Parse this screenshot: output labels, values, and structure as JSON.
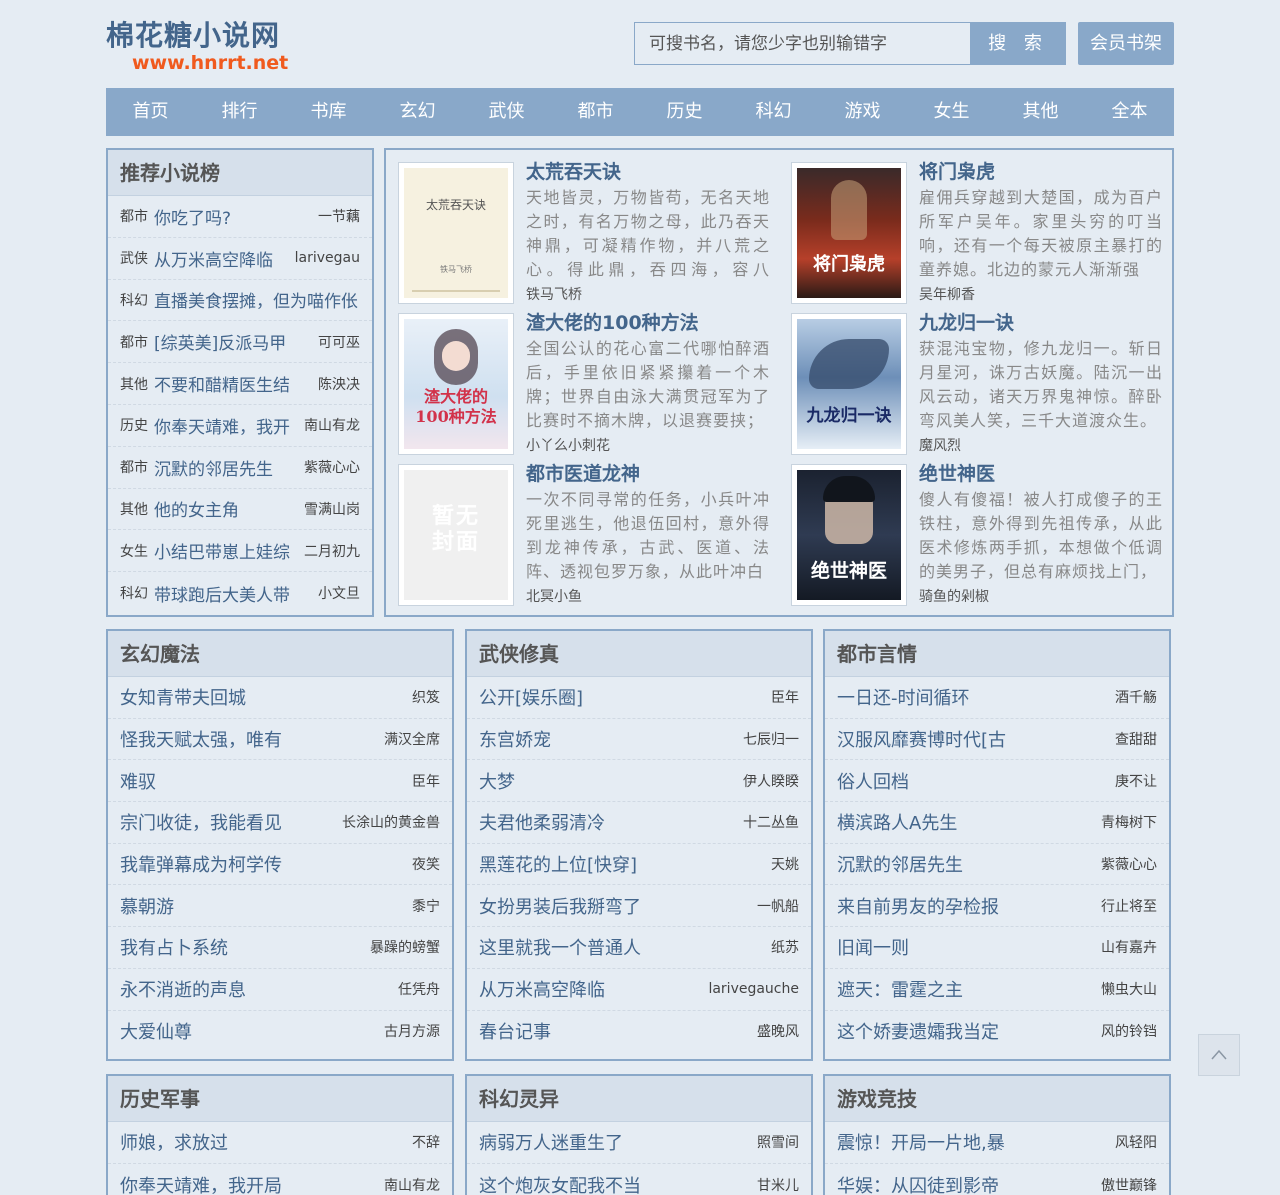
{
  "site": {
    "title": "棉花糖小说网",
    "url": "www.hnrrt.net"
  },
  "search": {
    "placeholder": "可搜书名，请您少字也别输错字",
    "button": "搜 索"
  },
  "member_button": "会员书架",
  "nav": [
    "首页",
    "排行",
    "书库",
    "玄幻",
    "武侠",
    "都市",
    "历史",
    "科幻",
    "游戏",
    "女生",
    "其他",
    "全本"
  ],
  "recommend": {
    "title": "推荐小说榜",
    "items": [
      {
        "cat": "都市",
        "title": "你吃了吗?",
        "author": "一节藕"
      },
      {
        "cat": "武侠",
        "title": "从万米高空降临",
        "author": "larivegau"
      },
      {
        "cat": "科幻",
        "title": "直播美食摆摊，但为喵作伥",
        "author": ""
      },
      {
        "cat": "都市",
        "title": "[综英美]反派马甲",
        "author": "可可巫"
      },
      {
        "cat": "其他",
        "title": "不要和醋精医生结",
        "author": "陈泱决"
      },
      {
        "cat": "历史",
        "title": "你奉天靖难，我开",
        "author": "南山有龙"
      },
      {
        "cat": "都市",
        "title": "沉默的邻居先生",
        "author": "紫薇心心"
      },
      {
        "cat": "其他",
        "title": "他的女主角",
        "author": "雪满山岗"
      },
      {
        "cat": "女生",
        "title": "小结巴带崽上娃综",
        "author": "二月初九"
      },
      {
        "cat": "科幻",
        "title": "带球跑后大美人带",
        "author": "小文旦"
      }
    ]
  },
  "featured": [
    {
      "title": "太荒吞天诀",
      "desc": "天地皆灵，万物皆苟，无名天地之时，有名万物之母，此乃吞天神鼎，可凝精作物，并八荒之心。得此鼎，吞四海，容八荒……",
      "author": "铁马飞桥",
      "cover_text": "太荒吞天诀",
      "cover_author": "铁马飞桥"
    },
    {
      "title": "将门枭虎",
      "desc": "雇佣兵穿越到大楚国，成为百户所军户吴年。家里头穷的叮当响，还有一个每天被原主暴打的童养媳。北边的蒙元人渐渐强",
      "author": "吴年柳香",
      "cover_text": "将门枭虎"
    },
    {
      "title": "渣大佬的100种方法",
      "desc": "全国公认的花心富二代哪怕醉酒后，手里依旧紧紧攥着一个木牌；世界自由泳大满贯冠军为了比赛时不摘木牌，以退赛要挟；",
      "author": "小丫么小刺花",
      "cover_text": "渣大佬的100种方法"
    },
    {
      "title": "九龙归一诀",
      "desc": "获混沌宝物，修九龙归一。斩日月星河，诛万古妖魔。陆沉一出风云动，诸天万界鬼神惊。醉卧弯风美人笑，三千大道渡众生。",
      "author": "魔风烈",
      "cover_text": "九龙归一诀"
    },
    {
      "title": "都市医道龙神",
      "desc": "一次不同寻常的任务，小兵叶冲死里逃生，他退伍回村，意外得到龙神传承，古武、医道、法阵、透视包罗万象，从此叶冲白",
      "author": "北冥小鱼",
      "cover_text": "暂无封面"
    },
    {
      "title": "绝世神医",
      "desc": "傻人有傻福！被人打成傻子的王铁柱，意外得到先祖传承，从此医术修炼两手抓，本想做个低调的美男子，但总有麻烦找上门，",
      "author": "骑鱼的剁椒",
      "cover_text": "绝世神医"
    }
  ],
  "categories": [
    {
      "title": "玄幻魔法",
      "items": [
        {
          "title": "女知青带夫回城",
          "author": "织笈"
        },
        {
          "title": "怪我天赋太强，唯有",
          "author": "满汉全席"
        },
        {
          "title": "难驭",
          "author": "臣年"
        },
        {
          "title": "宗门收徒，我能看见",
          "author": "长涂山的黄金兽"
        },
        {
          "title": "我靠弹幕成为柯学传",
          "author": "夜笑"
        },
        {
          "title": "慕朝游",
          "author": "黍宁"
        },
        {
          "title": "我有占卜系统",
          "author": "暴躁的螃蟹"
        },
        {
          "title": "永不消逝的声息",
          "author": "任凭舟"
        },
        {
          "title": "大爱仙尊",
          "author": "古月方源"
        }
      ]
    },
    {
      "title": "武侠修真",
      "items": [
        {
          "title": "公开[娱乐圈]",
          "author": "臣年"
        },
        {
          "title": "东宫娇宠",
          "author": "七辰归一"
        },
        {
          "title": "大梦",
          "author": "伊人睽睽"
        },
        {
          "title": "夫君他柔弱清冷",
          "author": "十二丛鱼"
        },
        {
          "title": "黑莲花的上位[快穿]",
          "author": "天姚"
        },
        {
          "title": "女扮男装后我掰弯了",
          "author": "一帆船"
        },
        {
          "title": "这里就我一个普通人",
          "author": "纸苏"
        },
        {
          "title": "从万米高空降临",
          "author": "larivegauche"
        },
        {
          "title": "春台记事",
          "author": "盛晚风"
        }
      ]
    },
    {
      "title": "都市言情",
      "items": [
        {
          "title": "一日还-时间循环",
          "author": "酒千觞"
        },
        {
          "title": "汉服风靡赛博时代[古",
          "author": "查甜甜"
        },
        {
          "title": "俗人回档",
          "author": "庚不让"
        },
        {
          "title": "横滨路人A先生",
          "author": "青梅树下"
        },
        {
          "title": "沉默的邻居先生",
          "author": "紫薇心心"
        },
        {
          "title": "来自前男友的孕检报",
          "author": "行止将至"
        },
        {
          "title": "旧闻一则",
          "author": "山有嘉卉"
        },
        {
          "title": "遮天：雷霆之主",
          "author": "懒虫大山"
        },
        {
          "title": "这个娇妻遗孀我当定",
          "author": "风的铃铛"
        }
      ]
    }
  ],
  "categories2": [
    {
      "title": "历史军事",
      "items": [
        {
          "title": "师娘，求放过",
          "author": "不辞"
        },
        {
          "title": "你奉天靖难，我开局",
          "author": "南山有龙"
        }
      ]
    },
    {
      "title": "科幻灵异",
      "items": [
        {
          "title": "病弱万人迷重生了",
          "author": "照雪间"
        },
        {
          "title": "这个炮灰女配我不当",
          "author": "甘米儿"
        }
      ]
    },
    {
      "title": "游戏竞技",
      "items": [
        {
          "title": "震惊！开局一片地,暴",
          "author": "风轻阳"
        },
        {
          "title": "华娱：从囚徒到影帝",
          "author": "傲世巅锋"
        }
      ]
    }
  ],
  "colors": {
    "accent": "#89a8c9",
    "link": "#43658b",
    "logo_url": "#f05a1e",
    "background": "#e5ecf3"
  }
}
